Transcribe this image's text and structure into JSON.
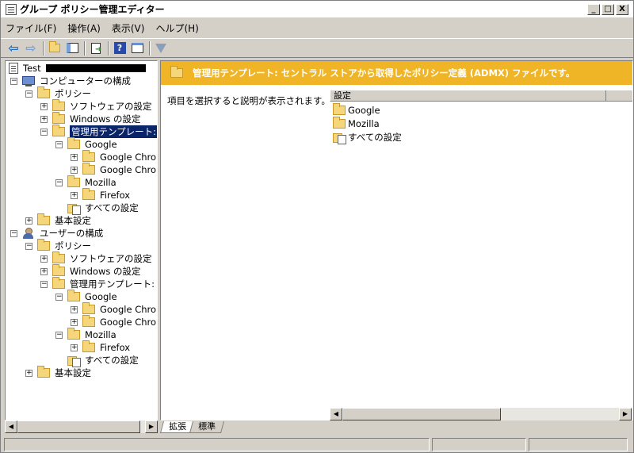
{
  "window": {
    "title": "グループ ポリシー管理エディター",
    "controls": {
      "minimize": "_",
      "maximize": "□",
      "close": "X"
    }
  },
  "menu": [
    {
      "label": "ファイル(F)"
    },
    {
      "label": "操作(A)"
    },
    {
      "label": "表示(V)"
    },
    {
      "label": "ヘルプ(H)"
    }
  ],
  "toolbar": [
    "back-icon",
    "forward-icon",
    "up-folder-icon",
    "show-hide-tree-icon",
    "export-list-icon",
    "help-icon",
    "properties-icon",
    "filter-icon"
  ],
  "tree": {
    "root": "Test",
    "computer": "コンピューターの構成",
    "user": "ユーザーの構成",
    "policy": "ポリシー",
    "software": "ソフトウェアの設定",
    "windows": "Windows の設定",
    "admin_templates": "管理用テンプレート: セ",
    "google": "Google",
    "google_chrome1": "Google Chrom",
    "google_chrome2": "Google Chrom",
    "mozilla": "Mozilla",
    "firefox": "Firefox",
    "all_settings": "すべての設定",
    "basic_settings": "基本設定"
  },
  "right": {
    "header": "管理用テンプレート: セントラル ストアから取得したポリシー定義 (ADMX) ファイルです。",
    "description": "項目を選択すると説明が表示されます。",
    "column_header": "設定",
    "items": [
      "Google",
      "Mozilla",
      "すべての設定"
    ]
  },
  "tabs": [
    "拡張",
    "標準"
  ],
  "colors": {
    "header_bg": "#f0b427",
    "selection": "#0a246a"
  }
}
